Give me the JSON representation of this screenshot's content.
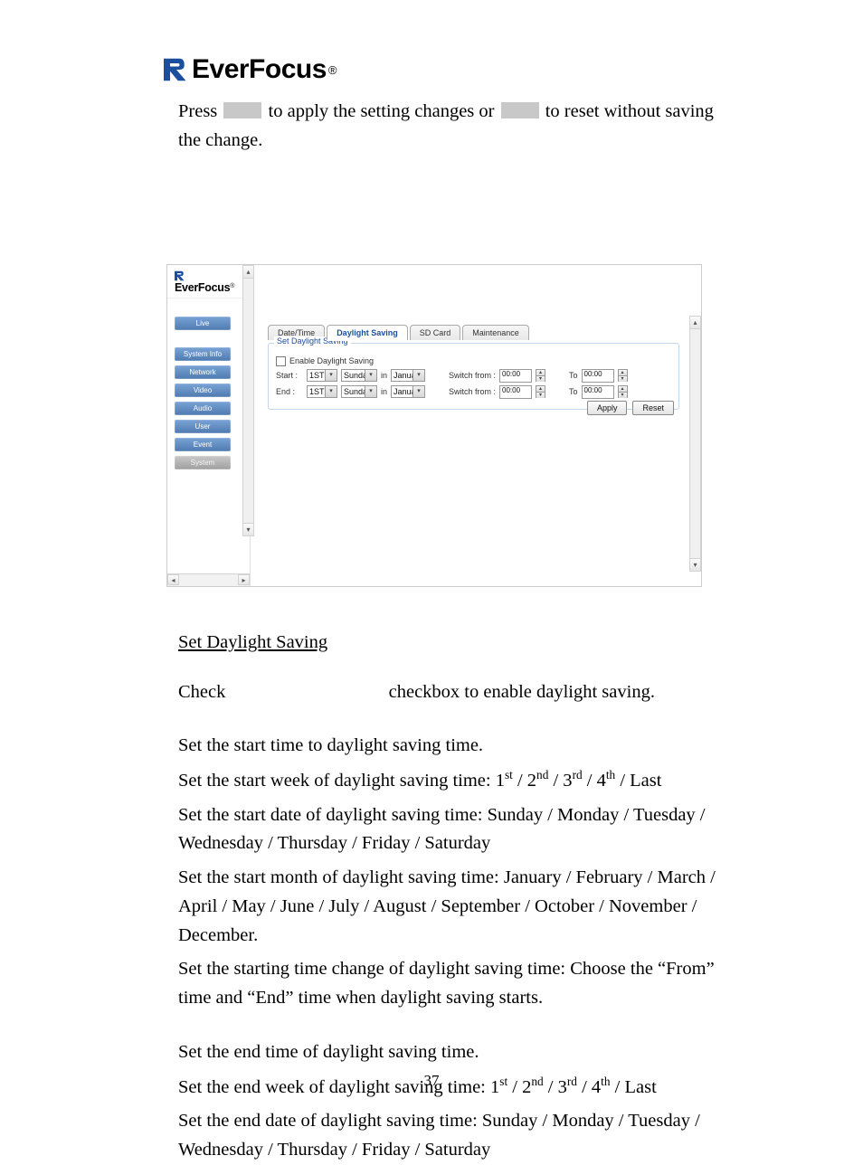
{
  "logo": {
    "brand": "EverFocus",
    "reg": "®"
  },
  "intro": {
    "press": "Press ",
    "mid": " to apply the setting changes or ",
    "tail": " to reset without saving the change."
  },
  "screenshot": {
    "brand": "EverFocus",
    "reg": "®",
    "nav": [
      "Live",
      "System Info",
      "Network",
      "Video",
      "Audio",
      "User",
      "Event",
      "System"
    ],
    "tabs": [
      "Date/Time",
      "Daylight Saving",
      "SD Card",
      "Maintenance"
    ],
    "active_tab_index": 1,
    "fieldset_legend": "Set Daylight Saving",
    "enable_label": "Enable Daylight Saving",
    "rows": [
      {
        "label": "Start :",
        "week": "1ST",
        "day": "Sunday",
        "in": "in",
        "month": "January",
        "switch": "Switch from :",
        "from": "00:00",
        "to_lbl": "To",
        "to": "00:00"
      },
      {
        "label": "End :",
        "week": "1ST",
        "day": "Sunday",
        "in": "in",
        "month": "January",
        "switch": "Switch from :",
        "from": "00:00",
        "to_lbl": "To",
        "to": "00:00"
      }
    ],
    "buttons": {
      "apply": "Apply",
      "reset": "Reset"
    }
  },
  "section_heading": "Set Daylight Saving",
  "body": {
    "p1a": "Check ",
    "p1b": " checkbox to enable daylight saving.",
    "p2": "Set the start time to daylight saving time.",
    "p3a": "Set the start week of daylight saving time: 1",
    "p3b": " / 2",
    "p3c": " / 3",
    "p3d": " / 4",
    "p3e": " / Last",
    "sup_st": "st",
    "sup_nd": "nd",
    "sup_rd": "rd",
    "sup_th": "th",
    "p4": "Set the start date of daylight saving time: Sunday / Monday / Tuesday / Wednesday / Thursday / Friday / Saturday",
    "p5": "Set the start month of daylight saving time: January / February / March / April / May / June / July / August / September / October / November / December.",
    "p6": "Set the starting time change of daylight saving time: Choose the “From” time and “End” time when daylight saving starts.",
    "p7": "Set the end time of daylight saving time.",
    "p8a": "Set the end week of daylight saving time: 1",
    "p8b": " / 2",
    "p8c": " / 3",
    "p8d": " / 4",
    "p8e": " / Last",
    "p9": "Set the end date of daylight saving time:  Sunday / Monday / Tuesday / Wednesday / Thursday / Friday / Saturday"
  },
  "page_number": "37"
}
